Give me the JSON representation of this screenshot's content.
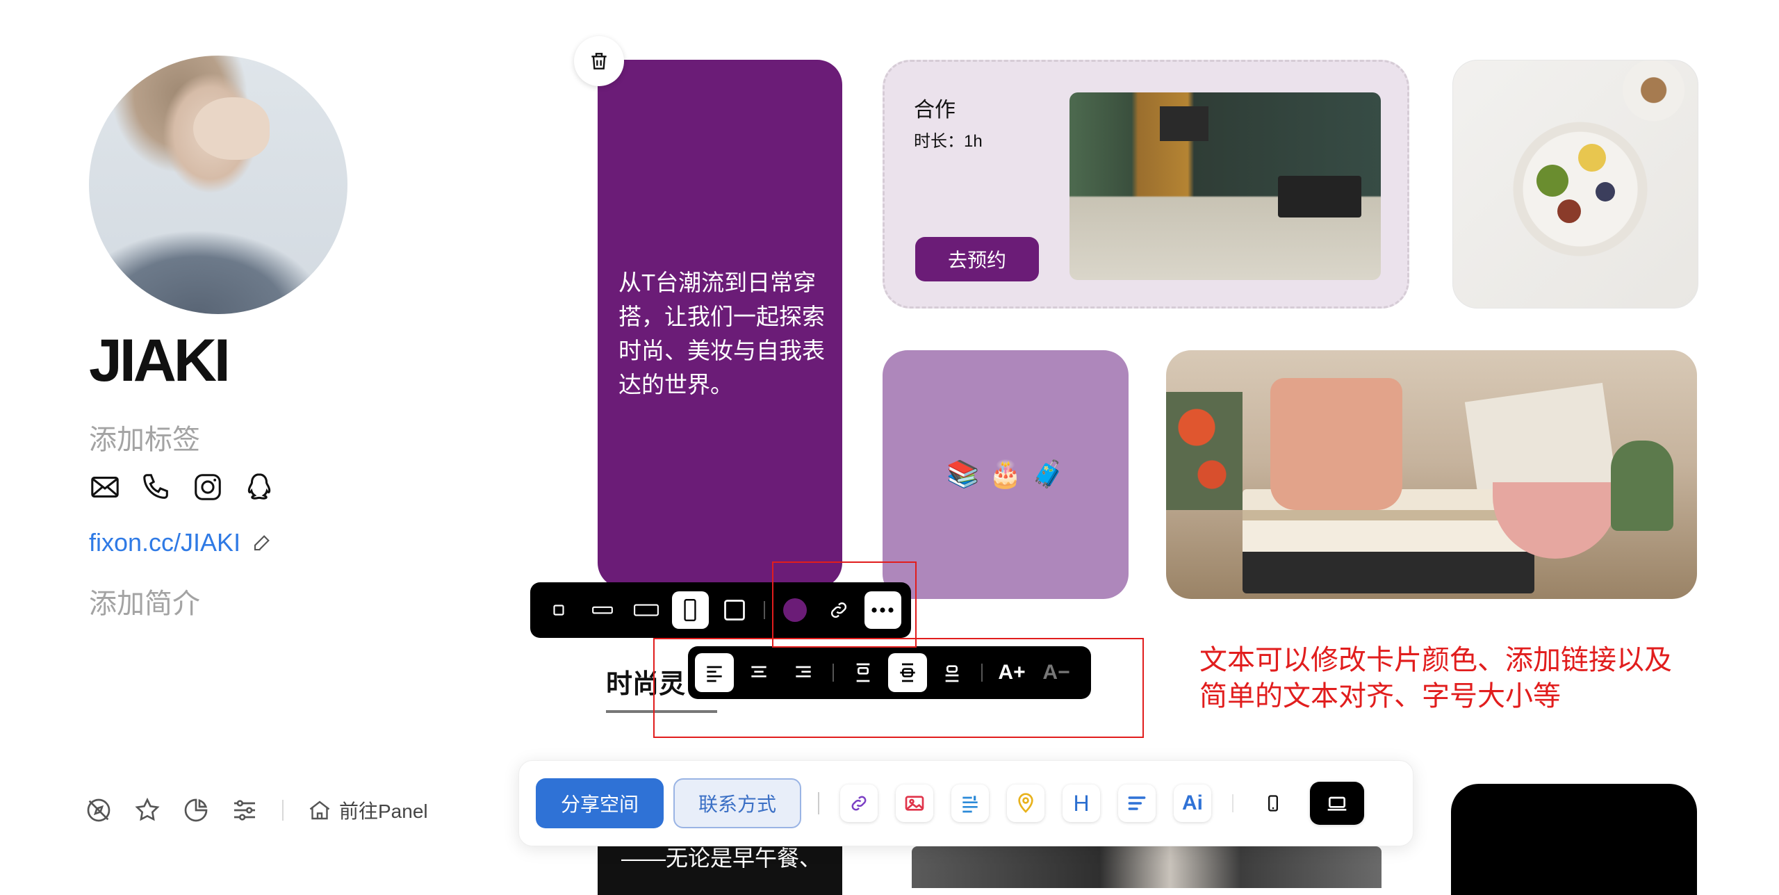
{
  "profile": {
    "name": "JIAKI",
    "tag_placeholder": "添加标签",
    "link": "fixon.cc/JIAKI",
    "bio_placeholder": "添加简介",
    "socials": [
      "mail-icon",
      "phone-icon",
      "instagram-icon",
      "qq-icon"
    ]
  },
  "bottom_left": {
    "icons": [
      "compass-off-icon",
      "star-icon",
      "pie-chart-icon",
      "sliders-icon"
    ],
    "panel_label": "前往Panel"
  },
  "cards": {
    "purple_text": "从T台潮流到日常穿搭，让我们一起探索时尚、美妆与自我表达的世界。",
    "collab": {
      "title": "合作",
      "duration": "时长：1h",
      "button": "去预约"
    },
    "emoji": [
      "📚",
      "🎂",
      "🧳"
    ],
    "bottom_text": "——无论是早午餐、"
  },
  "toolbar_top": {
    "sizes": [
      "size-small-square",
      "size-wide-short",
      "size-wide",
      "size-tall",
      "size-large-square"
    ],
    "active_size_index": 3,
    "color": "#6b1c77",
    "icons": [
      "link-icon",
      "more-icon"
    ]
  },
  "toolbar_text": {
    "align": [
      "align-left",
      "align-center",
      "align-right"
    ],
    "valign": [
      "valign-top",
      "valign-middle",
      "valign-bottom"
    ],
    "font_increase": "A+",
    "font_decrease": "A−"
  },
  "section_title": "时尚灵",
  "annotation": "文本可以修改卡片颜色、添加链接以及简单的文本对齐、字号大小等",
  "dock": {
    "share": "分享空间",
    "contact": "联系方式",
    "tools": [
      "link-icon",
      "image-icon",
      "text-icon",
      "location-icon",
      "heading-icon",
      "note-icon",
      "ai-icon"
    ],
    "heading_glyph": "H",
    "ai_glyph": "Ai",
    "views": [
      "mobile-view-icon",
      "desktop-view-icon"
    ]
  },
  "colors": {
    "accent": "#6b1c77",
    "annotation": "#e11d1d",
    "link": "#2f7ae5",
    "share": "#2f72d6"
  }
}
